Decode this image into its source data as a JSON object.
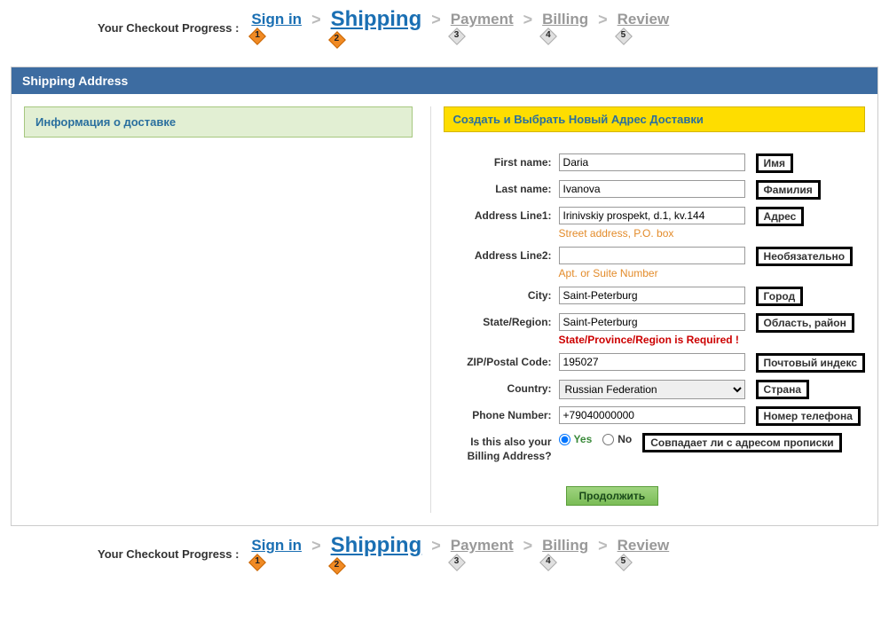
{
  "progress": {
    "label": "Your Checkout Progress :",
    "steps": [
      {
        "label": "Sign in",
        "num": "1"
      },
      {
        "label": "Shipping",
        "num": "2"
      },
      {
        "label": "Payment",
        "num": "3"
      },
      {
        "label": "Billing",
        "num": "4"
      },
      {
        "label": "Review",
        "num": "5"
      }
    ]
  },
  "panel": {
    "title": "Shipping Address"
  },
  "left": {
    "info_title": "Информация о доставке"
  },
  "right": {
    "create_title": "Создать и Выбрать Новый Адрес Доставки"
  },
  "form": {
    "first_name": {
      "label": "First name:",
      "value": "Daria",
      "annotation": "Имя"
    },
    "last_name": {
      "label": "Last name:",
      "value": "Ivanova",
      "annotation": "Фамилия"
    },
    "address1": {
      "label": "Address Line1:",
      "value": "Irinivskiy prospekt, d.1, kv.144",
      "hint": "Street address, P.O. box",
      "annotation": "Адрес"
    },
    "address2": {
      "label": "Address Line2:",
      "value": "",
      "hint": "Apt. or Suite Number",
      "annotation": "Необязательно"
    },
    "city": {
      "label": "City:",
      "value": "Saint-Peterburg",
      "annotation": "Город"
    },
    "state": {
      "label": "State/Region:",
      "value": "Saint-Peterburg",
      "error": "State/Province/Region is Required !",
      "annotation": "Область, район"
    },
    "zip": {
      "label": "ZIP/Postal Code:",
      "value": "195027",
      "annotation": "Почтовый индекс"
    },
    "country": {
      "label": "Country:",
      "value": "Russian Federation",
      "annotation": "Страна"
    },
    "phone": {
      "label": "Phone Number:",
      "value": "+79040000000",
      "annotation": "Номер телефона"
    },
    "billing": {
      "label": "Is this also your Billing Address?",
      "yes": "Yes",
      "no": "No",
      "annotation": "Совпадает ли с адресом прописки"
    },
    "continue": "Продолжить"
  }
}
